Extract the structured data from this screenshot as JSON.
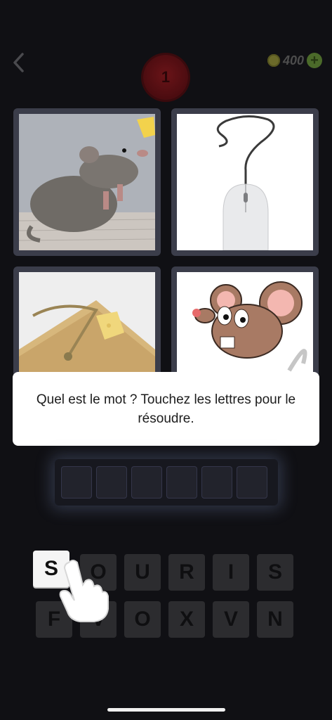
{
  "header": {
    "back_icon": "chevron-left-icon",
    "level": "1",
    "coins": "400",
    "coin_icon": "coin-icon",
    "add_icon": "plus-icon"
  },
  "tiles": [
    {
      "depicts": "mouse-rodent-photo"
    },
    {
      "depicts": "computer-mouse-photo"
    },
    {
      "depicts": "mousetrap-photo"
    },
    {
      "depicts": "cartoon-mouse"
    }
  ],
  "message": "Quel est le mot ? Touchez les lettres pour le résoudre.",
  "answer_slots": 6,
  "letters": [
    "S",
    "O",
    "U",
    "R",
    "I",
    "S",
    "F",
    "V",
    "O",
    "X",
    "V",
    "N"
  ],
  "active_letter_index": 0,
  "hint_icon": "pointing-hand-icon",
  "colors": {
    "background": "#101014",
    "badge": "#4b0c10",
    "tile_frame": "#3b3d4a",
    "key": "#2c2c2f",
    "key_active": "#f5f5f5"
  }
}
